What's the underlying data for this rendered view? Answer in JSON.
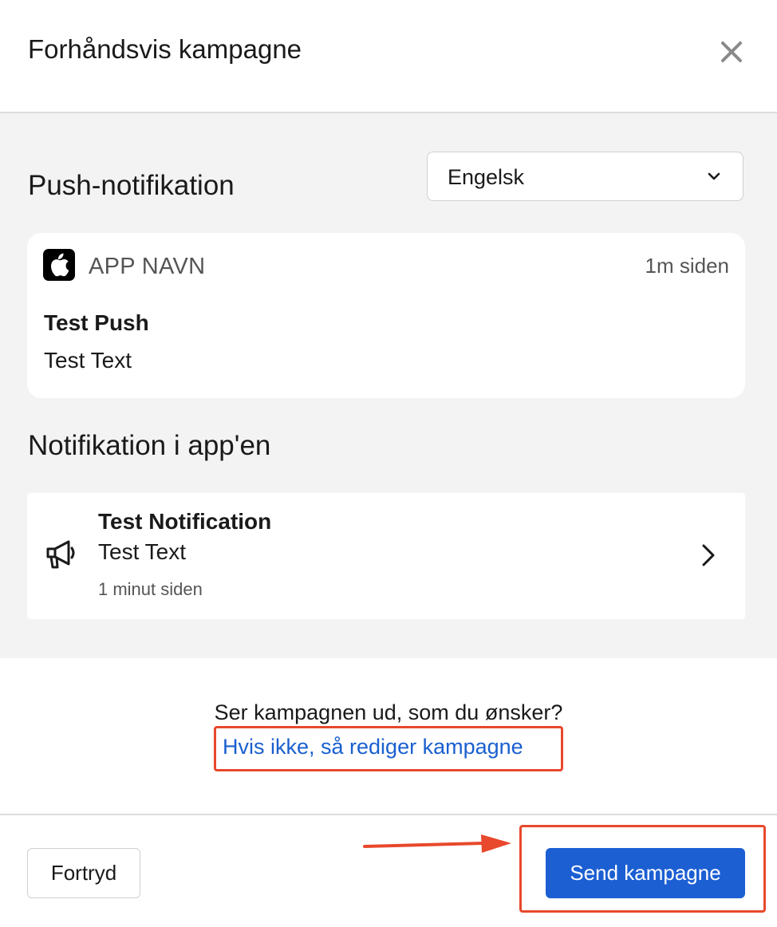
{
  "header": {
    "title": "Forhåndsvis kampagne",
    "close_icon": "close-icon"
  },
  "push": {
    "section_title": "Push-notifikation",
    "language_select": {
      "selected": "Engelsk",
      "icon": "chevron-down-icon"
    },
    "card": {
      "app_icon": "apple-logo-icon",
      "app_name": "APP NAVN",
      "time": "1m siden",
      "title": "Test Push",
      "body": "Test Text"
    }
  },
  "inapp": {
    "section_title": "Notifikation i app'en",
    "card": {
      "icon": "megaphone-icon",
      "title": "Test Notification",
      "body": "Test Text",
      "time": "1 minut siden",
      "chevron_icon": "chevron-right-icon"
    }
  },
  "confirm": {
    "question": "Ser kampagnen ud, som du ønsker?",
    "edit_link": "Hvis ikke, så rediger kampagne"
  },
  "footer": {
    "cancel_label": "Fortryd",
    "send_label": "Send kampagne"
  },
  "colors": {
    "primary": "#1c5fd3",
    "link": "#1a5fcf",
    "highlight": "#e8482c",
    "content_bg": "#f3f3f3"
  },
  "annotations": {
    "highlight_icon": "arrow-right-icon"
  }
}
